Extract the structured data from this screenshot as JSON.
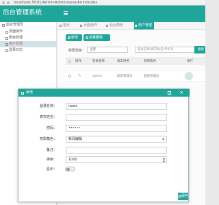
{
  "browser": {
    "url": "localhost:5001/AdminAdmin/sysadmin/index"
  },
  "header": {
    "title": "后台管理系统"
  },
  "sidebar": {
    "group_label": "后台管理员",
    "items": [
      {
        "label": "页面操作"
      },
      {
        "label": "角色管理"
      },
      {
        "label": "用户管理",
        "active": true
      },
      {
        "label": "登录日志"
      }
    ]
  },
  "tabs": [
    {
      "label": "首页"
    },
    {
      "label": "页面操作"
    },
    {
      "label": "后台角色"
    },
    {
      "label": "用户管理",
      "active": true
    }
  ],
  "toolbar": {
    "add_label": "新增",
    "batch_delete_label": "批量删除"
  },
  "filter": {
    "role_label": "权限角色：",
    "role_value": "全部",
    "search_placeholder": "登录名称/真实姓名/手机号",
    "search_label": "搜索"
  },
  "table": {
    "headers": [
      "操作",
      "登录名称",
      "真实姓名",
      "权限角色",
      "排行"
    ],
    "rows": [
      {
        "login": "admin",
        "real_name": "超级管理员",
        "role": "超级管理员"
      }
    ]
  },
  "dialog": {
    "title": "新增",
    "fields": {
      "login_label": "登录名称：",
      "login_value": "news",
      "real_name_label": "真实姓名：",
      "real_name_value": "",
      "password_label": "密码：",
      "password_value": "••••••",
      "role_label": "权限角色：",
      "role_value": "新闻编辑",
      "note_label": "备注：",
      "note_value": "",
      "sort_label": "排序：",
      "sort_value": "1000",
      "display_label": "显示："
    },
    "save_label": "保存"
  },
  "colors": {
    "accent": "#20a59a",
    "active_side": "#cfe3e7"
  }
}
